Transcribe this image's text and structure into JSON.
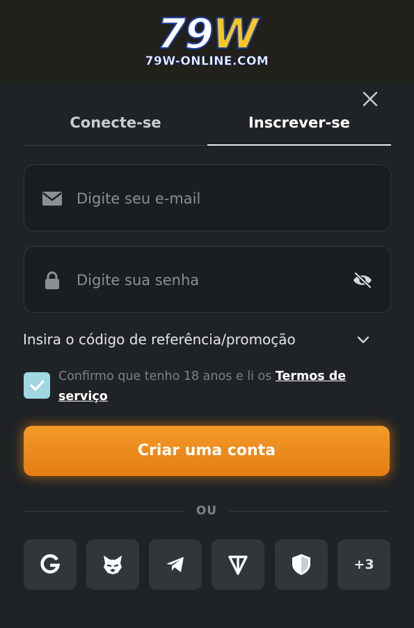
{
  "header": {
    "logo_number": "79",
    "logo_letter": "W",
    "logo_domain": "79W-ONLINE.COM"
  },
  "tabs": [
    {
      "label": "Conecte-se",
      "active": false
    },
    {
      "label": "Inscrever-se",
      "active": true
    }
  ],
  "form": {
    "email": {
      "placeholder": "Digite seu e-mail",
      "value": "",
      "icon": "envelope-icon"
    },
    "password": {
      "placeholder": "Digite sua senha",
      "value": "",
      "icon": "lock-icon",
      "toggle_icon": "eye-slash-icon"
    },
    "promo_label": "Insira o código de referência/promoção",
    "terms": {
      "checked": true,
      "text": "Confirmo que tenho 18 anos e li os",
      "link_text": "Termos de serviço"
    },
    "submit_label": "Criar uma conta",
    "divider_label": "OU"
  },
  "social_logins": [
    {
      "name": "google",
      "icon": "google-icon"
    },
    {
      "name": "metamask",
      "icon": "metamask-fox-icon"
    },
    {
      "name": "telegram",
      "icon": "telegram-icon"
    },
    {
      "name": "ton",
      "icon": "ton-icon"
    },
    {
      "name": "shield",
      "icon": "shield-icon"
    },
    {
      "name": "more",
      "label": "+3"
    }
  ],
  "colors": {
    "background": "#1f2325",
    "header_bg": "#22201a",
    "accent_orange": "#ef8c1e",
    "checkbox": "#9fd7e2",
    "social_button": "#30363a"
  }
}
